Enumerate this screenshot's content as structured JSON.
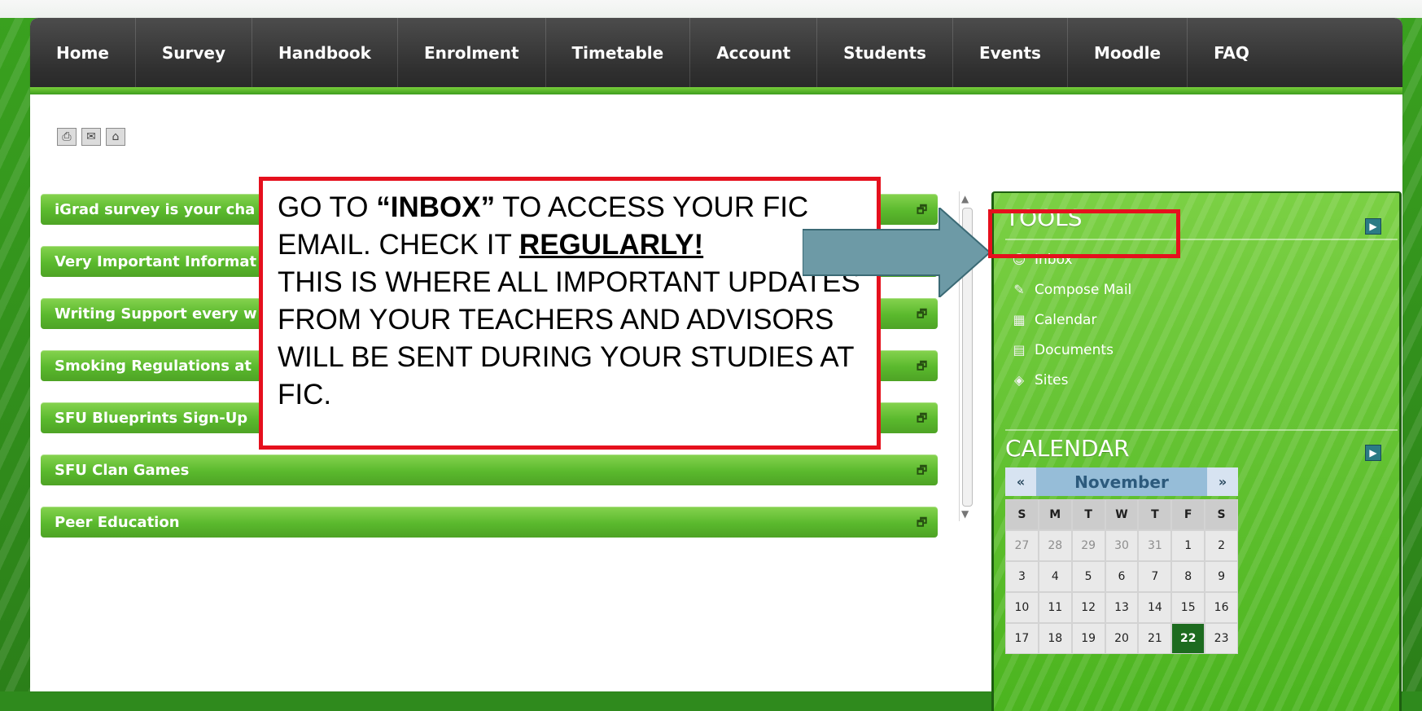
{
  "nav": {
    "items": [
      "Home",
      "Survey",
      "Handbook",
      "Enrolment",
      "Timetable",
      "Account",
      "Students",
      "Events",
      "Moodle",
      "FAQ"
    ]
  },
  "toolbar": {
    "icons": [
      "print-icon",
      "email-icon",
      "home-icon"
    ]
  },
  "accordion": {
    "items": [
      {
        "title": "iGrad survey is your cha"
      },
      {
        "title": "Very Important Informat"
      },
      {
        "title": "Writing Support every w"
      },
      {
        "title": "Smoking Regulations at"
      },
      {
        "title": "SFU Blueprints Sign-Up"
      },
      {
        "title": "SFU Clan Games"
      },
      {
        "title": "Peer Education"
      }
    ]
  },
  "callout": {
    "line1_prefix": "GO TO ",
    "line1_strong": "“INBOX”",
    "line1_suffix": " TO ACCESS YOUR FIC",
    "line2_prefix": "EMAIL. CHECK IT ",
    "line2_strong": "REGULARLY!",
    "line3": "THIS IS WHERE ALL IMPORTANT UPDATES",
    "line4": "FROM YOUR TEACHERS AND ADVISORS",
    "line5": "WILL BE SENT DURING YOUR STUDIES AT",
    "line6": "FIC."
  },
  "sidebar": {
    "tools_title": "TOOLS",
    "tools_items": [
      {
        "label": "Inbox",
        "icon": "inbox-icon"
      },
      {
        "label": "Compose Mail",
        "icon": "compose-icon"
      },
      {
        "label": "Calendar",
        "icon": "calendar-icon"
      },
      {
        "label": "Documents",
        "icon": "documents-icon"
      },
      {
        "label": "Sites",
        "icon": "sites-icon"
      }
    ],
    "calendar_title": "CALENDAR",
    "calendar": {
      "prev": "«",
      "next": "»",
      "month": "November",
      "weekday_headers": [
        "S",
        "M",
        "T",
        "W",
        "T",
        "F",
        "S"
      ],
      "rows": [
        [
          "27",
          "28",
          "29",
          "30",
          "31",
          "1",
          "2"
        ],
        [
          "3",
          "4",
          "5",
          "6",
          "7",
          "8",
          "9"
        ],
        [
          "10",
          "11",
          "12",
          "13",
          "14",
          "15",
          "16"
        ],
        [
          "17",
          "18",
          "19",
          "20",
          "21",
          "22",
          "23"
        ]
      ],
      "today": "22"
    }
  },
  "colors": {
    "highlight_red": "#e5101d",
    "nav_accent": "#5ab92d",
    "arrow_fill": "#6d9aa6"
  }
}
